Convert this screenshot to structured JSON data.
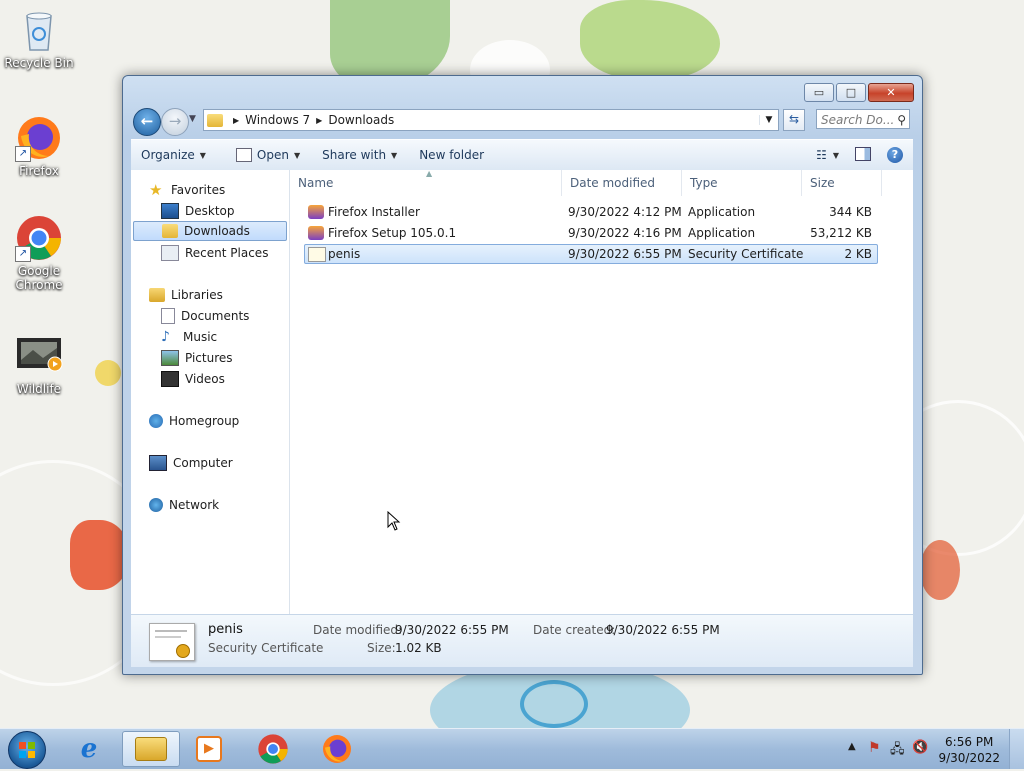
{
  "desktop": {
    "icons": [
      {
        "label": "Recycle Bin",
        "icon": "recycle-bin-icon"
      },
      {
        "label": "Firefox",
        "icon": "firefox-icon"
      },
      {
        "label": "Google Chrome",
        "icon": "chrome-icon"
      },
      {
        "label": "Wildlife",
        "icon": "video-file-icon"
      }
    ]
  },
  "window": {
    "controls": {
      "minimize": "▭",
      "maximize": "□",
      "close": "✕"
    },
    "address": {
      "crumbs": [
        "Windows 7",
        "Downloads"
      ]
    },
    "search_placeholder": "Search Do...",
    "toolbar": {
      "organize": "Organize",
      "open": "Open",
      "share_with": "Share with",
      "new_folder": "New folder"
    },
    "nav": {
      "favorites": "Favorites",
      "desktop": "Desktop",
      "downloads": "Downloads",
      "recent_places": "Recent Places",
      "libraries": "Libraries",
      "documents": "Documents",
      "music": "Music",
      "pictures": "Pictures",
      "videos": "Videos",
      "homegroup": "Homegroup",
      "computer": "Computer",
      "network": "Network"
    },
    "columns": {
      "name": "Name",
      "date_modified": "Date modified",
      "type": "Type",
      "size": "Size"
    },
    "files": [
      {
        "name": "Firefox Installer",
        "date": "9/30/2022 4:12 PM",
        "type": "Application",
        "size": "344 KB"
      },
      {
        "name": "Firefox Setup 105.0.1",
        "date": "9/30/2022 4:16 PM",
        "type": "Application",
        "size": "53,212 KB"
      },
      {
        "name": "penis",
        "date": "9/30/2022 6:55 PM",
        "type": "Security Certificate",
        "size": "2 KB"
      }
    ],
    "details": {
      "name": "penis",
      "type": "Security Certificate",
      "date_modified_label": "Date modified:",
      "date_modified": "9/30/2022 6:55 PM",
      "date_created_label": "Date created:",
      "date_created": "9/30/2022 6:55 PM",
      "size_label": "Size:",
      "size": "1.02 KB"
    }
  },
  "taskbar": {
    "clock_time": "6:56 PM",
    "clock_date": "9/30/2022",
    "pinned": [
      "internet-explorer-icon",
      "windows-explorer-icon",
      "media-player-icon",
      "chrome-icon",
      "firefox-icon"
    ]
  }
}
